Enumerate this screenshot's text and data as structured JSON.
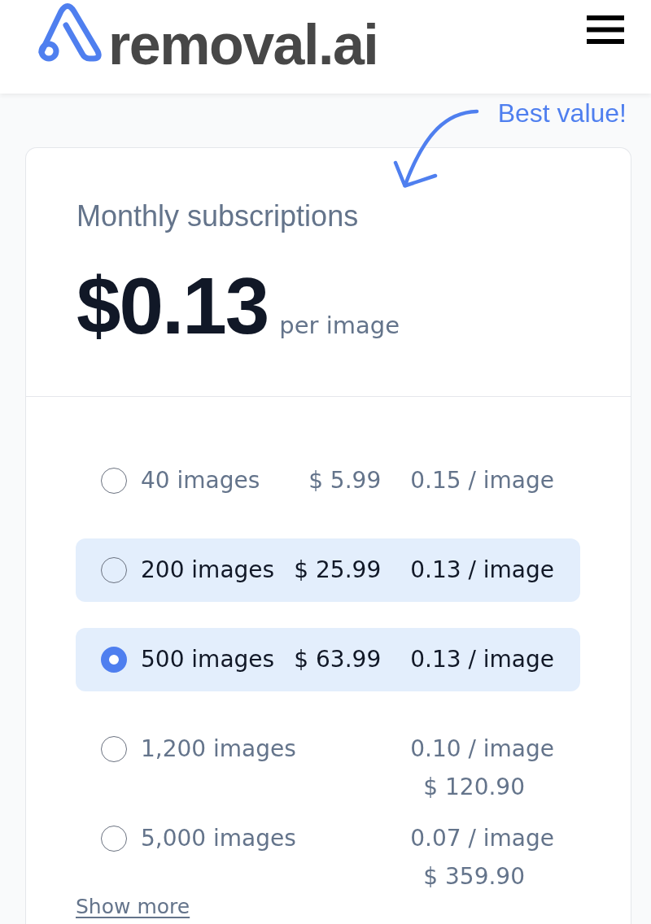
{
  "header": {
    "logo_text": "removal.ai"
  },
  "callout": {
    "text": "Best value!"
  },
  "plan": {
    "title": "Monthly subscriptions",
    "price": "$0.13",
    "unit": "per image"
  },
  "options": [
    {
      "images": "40 images",
      "price": "$ 5.99",
      "per_image": "0.15 / image",
      "highlighted": false,
      "selected": false
    },
    {
      "images": "200 images",
      "price": "$ 25.99",
      "per_image": "0.13 / image",
      "highlighted": true,
      "selected": false
    },
    {
      "images": "500 images",
      "price": "$ 63.99",
      "per_image": "0.13 / image",
      "highlighted": true,
      "selected": true
    },
    {
      "images": "1,200 images",
      "price": "$ 120.90",
      "per_image": "0.10 / image",
      "highlighted": false,
      "selected": false
    },
    {
      "images": "5,000 images",
      "price": "$ 359.90",
      "per_image": "0.07 / image",
      "highlighted": false,
      "selected": false
    }
  ],
  "show_more": "Show more"
}
